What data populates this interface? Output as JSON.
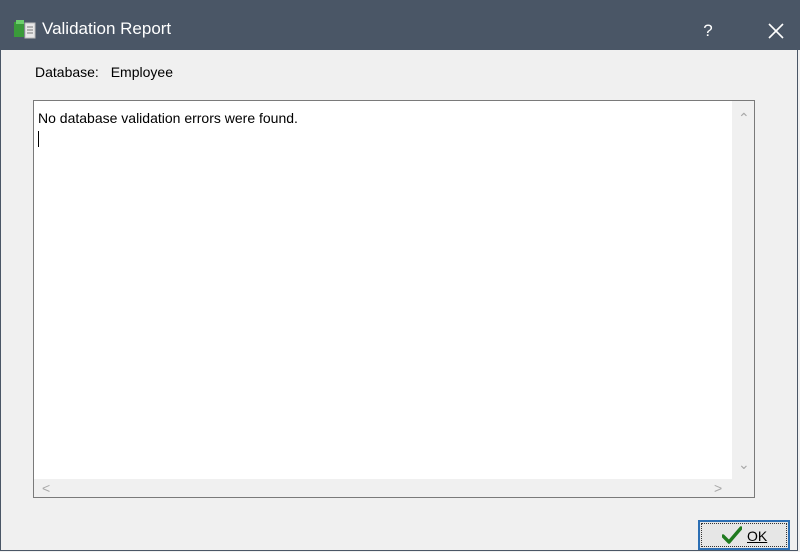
{
  "window": {
    "title": "Validation Report",
    "help_label": "?"
  },
  "database": {
    "label": "Database:",
    "value": "Employee"
  },
  "report": {
    "text": "No database validation errors were found."
  },
  "scrollbar": {
    "up": "⌃",
    "down": "⌄",
    "left": "<",
    "right": ">"
  },
  "ok_button": {
    "label": "OK"
  },
  "colors": {
    "titlebar": "#4a5666",
    "ok_border": "#2c6fb4",
    "check": "#1f7a1f"
  },
  "icons": [
    "app-database-icon",
    "close-icon",
    "checkmark-icon"
  ]
}
